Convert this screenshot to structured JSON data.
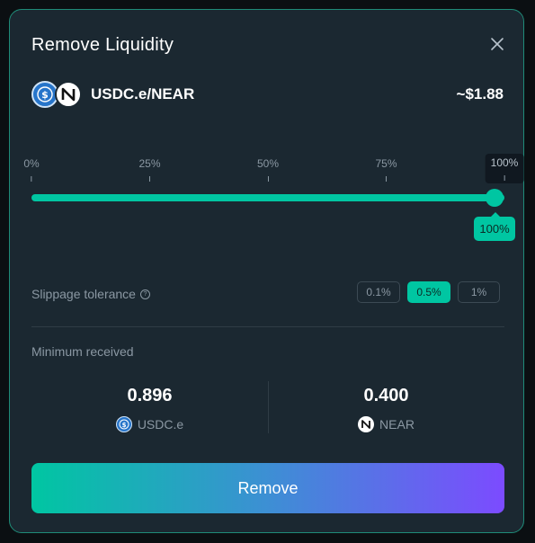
{
  "modal": {
    "title": "Remove Liquidity",
    "close_icon": "close-icon"
  },
  "pair": {
    "name": "USDC.e/NEAR",
    "value": "~$1.88",
    "token_icons": [
      "usdc-icon",
      "near-icon"
    ]
  },
  "slider": {
    "ticks": [
      "0%",
      "25%",
      "50%",
      "75%",
      "100%"
    ],
    "value_percent": 100,
    "value_label": "100%"
  },
  "slippage": {
    "label": "Slippage tolerance",
    "help_icon": "help-icon",
    "options": [
      "0.1%",
      "0.5%",
      "1%"
    ],
    "selected": "0.5%"
  },
  "minimum": {
    "label": "Minimum received",
    "tokens": [
      {
        "amount": "0.896",
        "symbol": "USDC.e",
        "icon": "usdc-icon"
      },
      {
        "amount": "0.400",
        "symbol": "NEAR",
        "icon": "near-icon"
      }
    ]
  },
  "action": {
    "remove_label": "Remove"
  },
  "colors": {
    "accent": "#00c6a2",
    "panel": "#1b2831",
    "border": "#1f8b78",
    "button_gradient": [
      "#00c6a2",
      "#7c4bff"
    ]
  }
}
